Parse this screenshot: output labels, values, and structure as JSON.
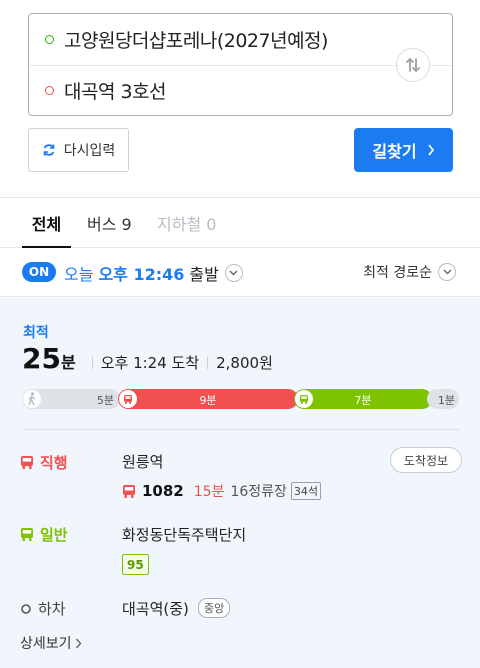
{
  "search": {
    "origin": "고양원당더샵포레나(2027년예정)",
    "destination": "대곡역 3호선"
  },
  "actions": {
    "reset_label": "다시입력",
    "route_label": "길찾기"
  },
  "tabs": [
    {
      "label": "전체",
      "active": true
    },
    {
      "label": "버스 9",
      "active": false
    },
    {
      "label": "지하철 0",
      "active": false
    }
  ],
  "timebar": {
    "toggle": "ON",
    "today": "오늘",
    "time": "오후 12:46",
    "label": "출발",
    "sort": "최적 경로순"
  },
  "result": {
    "badge": "최적",
    "duration": "25",
    "duration_unit": "분",
    "arrival": "오후 1:24 도착",
    "fare": "2,800원",
    "segments": [
      {
        "type": "walk",
        "label": "5분"
      },
      {
        "type": "bus",
        "label": "9분"
      },
      {
        "type": "bus",
        "label": "7분"
      },
      {
        "type": "walk",
        "label": "1분"
      }
    ],
    "steps": [
      {
        "type": "직행",
        "stop": "원릉역",
        "bus": "1082",
        "minutes": "15분",
        "stops": "16정류장",
        "seats": "34석",
        "arrival_btn": "도착정보"
      },
      {
        "type": "일반",
        "stop": "화정동단독주택단지",
        "bus": "95"
      },
      {
        "type": "하차",
        "stop": "대곡역(중)",
        "line": "중앙"
      }
    ],
    "detail": "상세보기"
  },
  "colors": {
    "accent": "#1b7cf2",
    "red_bus": "#f24f4f",
    "green_bus": "#7dc300"
  }
}
